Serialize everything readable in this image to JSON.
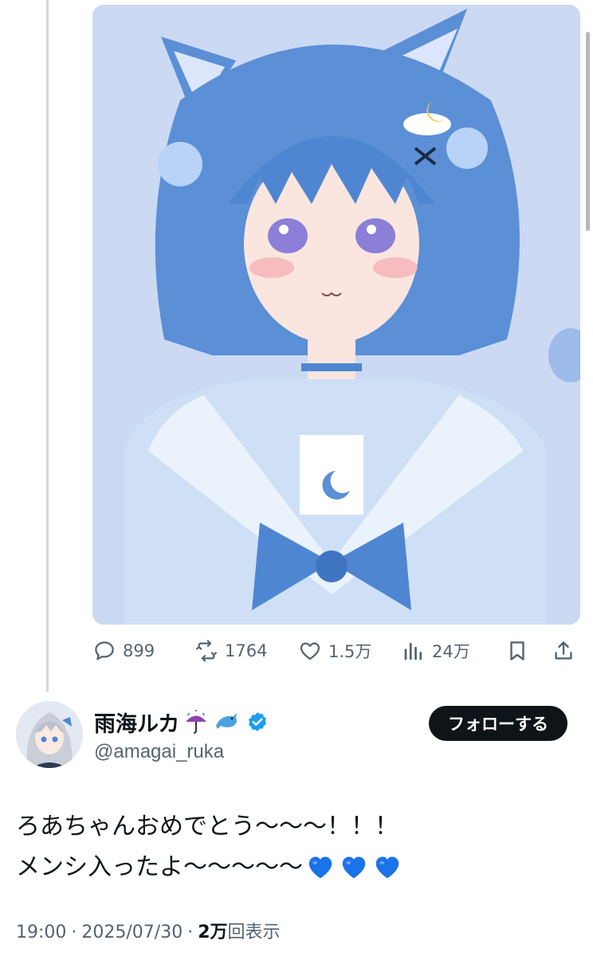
{
  "tweet_media": {
    "subject": "Anime illustration of a girl with short blue hair, cat ears, cloud-and-moon hair clip, sailor outfit with blue bow",
    "background_color": "#c9d8f2",
    "hair_color": "#5b8fd6"
  },
  "actions": {
    "reply_count": "899",
    "retweet_count": "1764",
    "like_count": "1.5万",
    "view_count": "24万"
  },
  "author": {
    "display_name": "雨海ルカ",
    "name_emojis": [
      "umbrella-rain-emoji",
      "dolphin-emoji"
    ],
    "verified": true,
    "handle": "@amagai_ruka",
    "follow_label": "フォローする"
  },
  "tweet": {
    "line1": "ろあちゃんおめでとう〜〜〜！！！",
    "line2": "メンシ入ったよ〜〜〜〜〜",
    "hearts": [
      "blue-heart-emoji",
      "blue-heart-emoji",
      "blue-heart-emoji"
    ]
  },
  "meta": {
    "time": "19:00",
    "date": "2025/07/30",
    "views_count": "2万",
    "views_label": "回表示",
    "separator": "·"
  },
  "colors": {
    "text_primary": "#0f1419",
    "text_secondary": "#536471",
    "verified_blue": "#1d9bf0",
    "heart_blue": "#1a73e8",
    "thread_line": "#cfd9de"
  }
}
